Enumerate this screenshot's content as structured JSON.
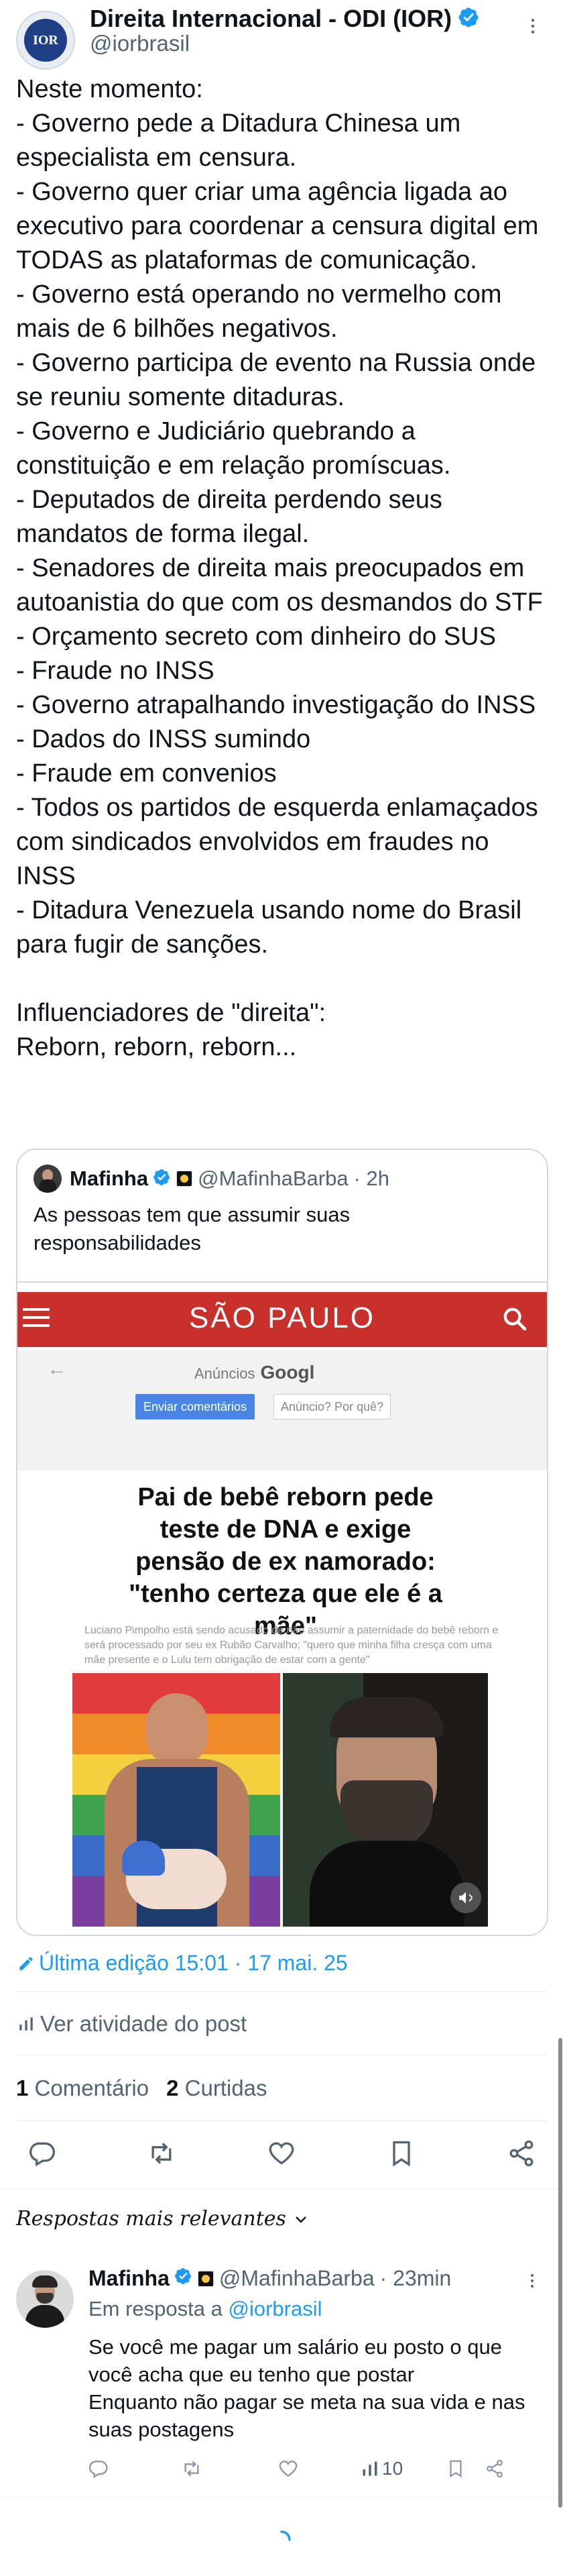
{
  "post": {
    "author_name": "Direita Internacional - ODI (IOR)",
    "author_handle": "@iorbrasil",
    "avatar_text": "IOR",
    "text": "Neste momento:\n- Governo pede a Ditadura Chinesa um especialista em censura.\n- Governo quer criar uma agência ligada ao executivo para coordenar a censura digital em TODAS as plataformas de comunicação.\n- Governo está operando no vermelho com mais de 6 bilhões negativos.\n- Governo participa de evento na Russia onde se reuniu somente ditaduras.\n- Governo e Judiciário quebrando a constituição e em relação promíscuas.\n- Deputados de direita perdendo seus mandatos de forma ilegal.\n- Senadores de direita mais preocupados em autoanistia do que com os desmandos do STF\n- Orçamento secreto com dinheiro do SUS\n- Fraude no INSS\n- Governo atrapalhando investigação do INSS\n- Dados do INSS sumindo\n- Fraude em convenios\n- Todos os partidos de esquerda enlamaçados com sindicados envolvidos em fraudes no INSS\n- Ditadura Venezuela usando nome do Brasil para fugir de sanções.\n\nInfluenciadores de \"direita\":\nReborn, reborn, reborn...",
    "last_edit": "Última edição 15:01 · 17 mai. 25",
    "view_activity": "Ver atividade do post",
    "comments_count": "1",
    "comments_label": "Comentário",
    "likes_count": "2",
    "likes_label": "Curtidas"
  },
  "quote": {
    "author_name": "Mafinha",
    "author_handle": "@MafinhaBarba",
    "time": "· 2h",
    "text": "As pessoas tem que assumir suas responsabilidades",
    "image": {
      "site_title": "SÃO PAULO",
      "ads_label": "Anúncios",
      "ads_brand": "Googl",
      "send_feedback": "Enviar comentários",
      "why_ad": "Anúncio? Por quê?",
      "headline": "Pai de bebê reborn pede teste de DNA e exige pensão de ex namorado: \"tenho certeza que ele é a mãe\"",
      "body": "Luciano Pimpolho está sendo acusado de não assumir a paternidade do bebê reborn e será processado por seu ex Rubão Carvalho; \"quero que minha filha cresça com uma mãe presente e o Lulu tem obrigação de estar com a gente\""
    }
  },
  "replies_sort": "Respostas mais relevantes",
  "reply": {
    "author_name": "Mafinha",
    "author_handle": "@MafinhaBarba",
    "time": "· 23min",
    "in_reply_prefix": "Em resposta a",
    "in_reply_handle": "@iorbrasil",
    "text": "Se você me pagar um salário eu posto o que você acha que eu tenho que postar\nEnquanto não pagar se meta na sua vida e nas suas postagens",
    "views": "10"
  },
  "colors": {
    "accent": "#1d9bf0",
    "site_red": "#c8312b",
    "muted": "#536471",
    "divider": "#eff3f4"
  },
  "icons": [
    "more-icon",
    "verified-icon",
    "pencil-icon",
    "analytics-icon",
    "reply-icon",
    "repost-icon",
    "like-icon",
    "bookmark-icon",
    "share-icon",
    "chevron-down-icon",
    "menu-icon",
    "search-icon",
    "mute-icon",
    "spinner-icon"
  ]
}
